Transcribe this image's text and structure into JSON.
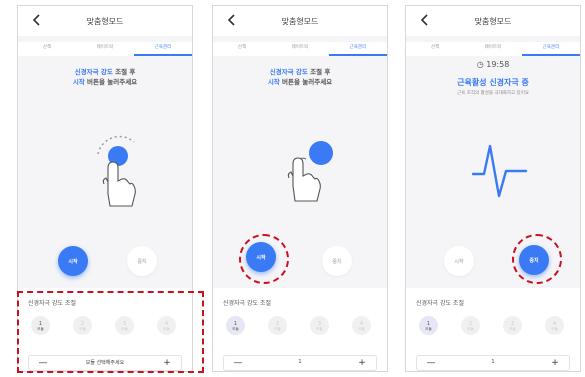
{
  "screens": [
    {
      "title": "맞춤형모드",
      "tabs": [
        "산책",
        "웨이트락",
        "근육관리"
      ],
      "instruction_line1_accent": "신경자극 강도",
      "instruction_line1_rest": " 조절 후",
      "instruction_line2_accent": "시작",
      "instruction_line2_rest": " 버튼을 눌러주세요",
      "start_label": "시작",
      "stop_label": "중지",
      "panel_title": "신경자극 강도 조절",
      "levels": [
        {
          "num": "1",
          "mode": "모듈"
        },
        {
          "num": "2",
          "mode": "모듈"
        },
        {
          "num": "3",
          "mode": "모듈"
        },
        {
          "num": "4",
          "mode": "모듈"
        }
      ],
      "stepper_value": "모듈 선택해주세요",
      "minus": "—",
      "plus": "+"
    },
    {
      "title": "맞춤형모드",
      "tabs": [
        "산책",
        "웨이트락",
        "근육관리"
      ],
      "instruction_line1_accent": "신경자극 강도",
      "instruction_line1_rest": " 조절 후",
      "instruction_line2_accent": "시작",
      "instruction_line2_rest": " 버튼을 눌러주세요",
      "start_label": "시작",
      "stop_label": "중지",
      "panel_title": "신경자극 강도 조절",
      "levels": [
        {
          "num": "1",
          "mode": "모듈"
        },
        {
          "num": "2",
          "mode": "모듈"
        },
        {
          "num": "3",
          "mode": "모듈"
        },
        {
          "num": "4",
          "mode": "모듈"
        }
      ],
      "stepper_value": "1",
      "minus": "—",
      "plus": "+"
    },
    {
      "title": "맞춤형모드",
      "tabs": [
        "산책",
        "웨이트락",
        "근육관리"
      ],
      "timer": "19:58",
      "status": "근육활성 신경자극 중",
      "subtext": "근육 조직의 활성을 극대화하고 있어요",
      "start_label": "시작",
      "stop_label": "중지",
      "panel_title": "신경자극 강도 조절",
      "levels": [
        {
          "num": "1",
          "mode": "모듈"
        },
        {
          "num": "2",
          "mode": "모듈"
        },
        {
          "num": "3",
          "mode": "모듈"
        },
        {
          "num": "4",
          "mode": "모듈"
        }
      ],
      "stepper_value": "1",
      "minus": "—",
      "plus": "+"
    }
  ],
  "colors": {
    "accent": "#3a7bf5",
    "highlight": "#cc1020"
  },
  "icons": [
    "back-chevron-icon",
    "tap-hand-icon",
    "clock-icon",
    "pulse-wave-icon"
  ]
}
